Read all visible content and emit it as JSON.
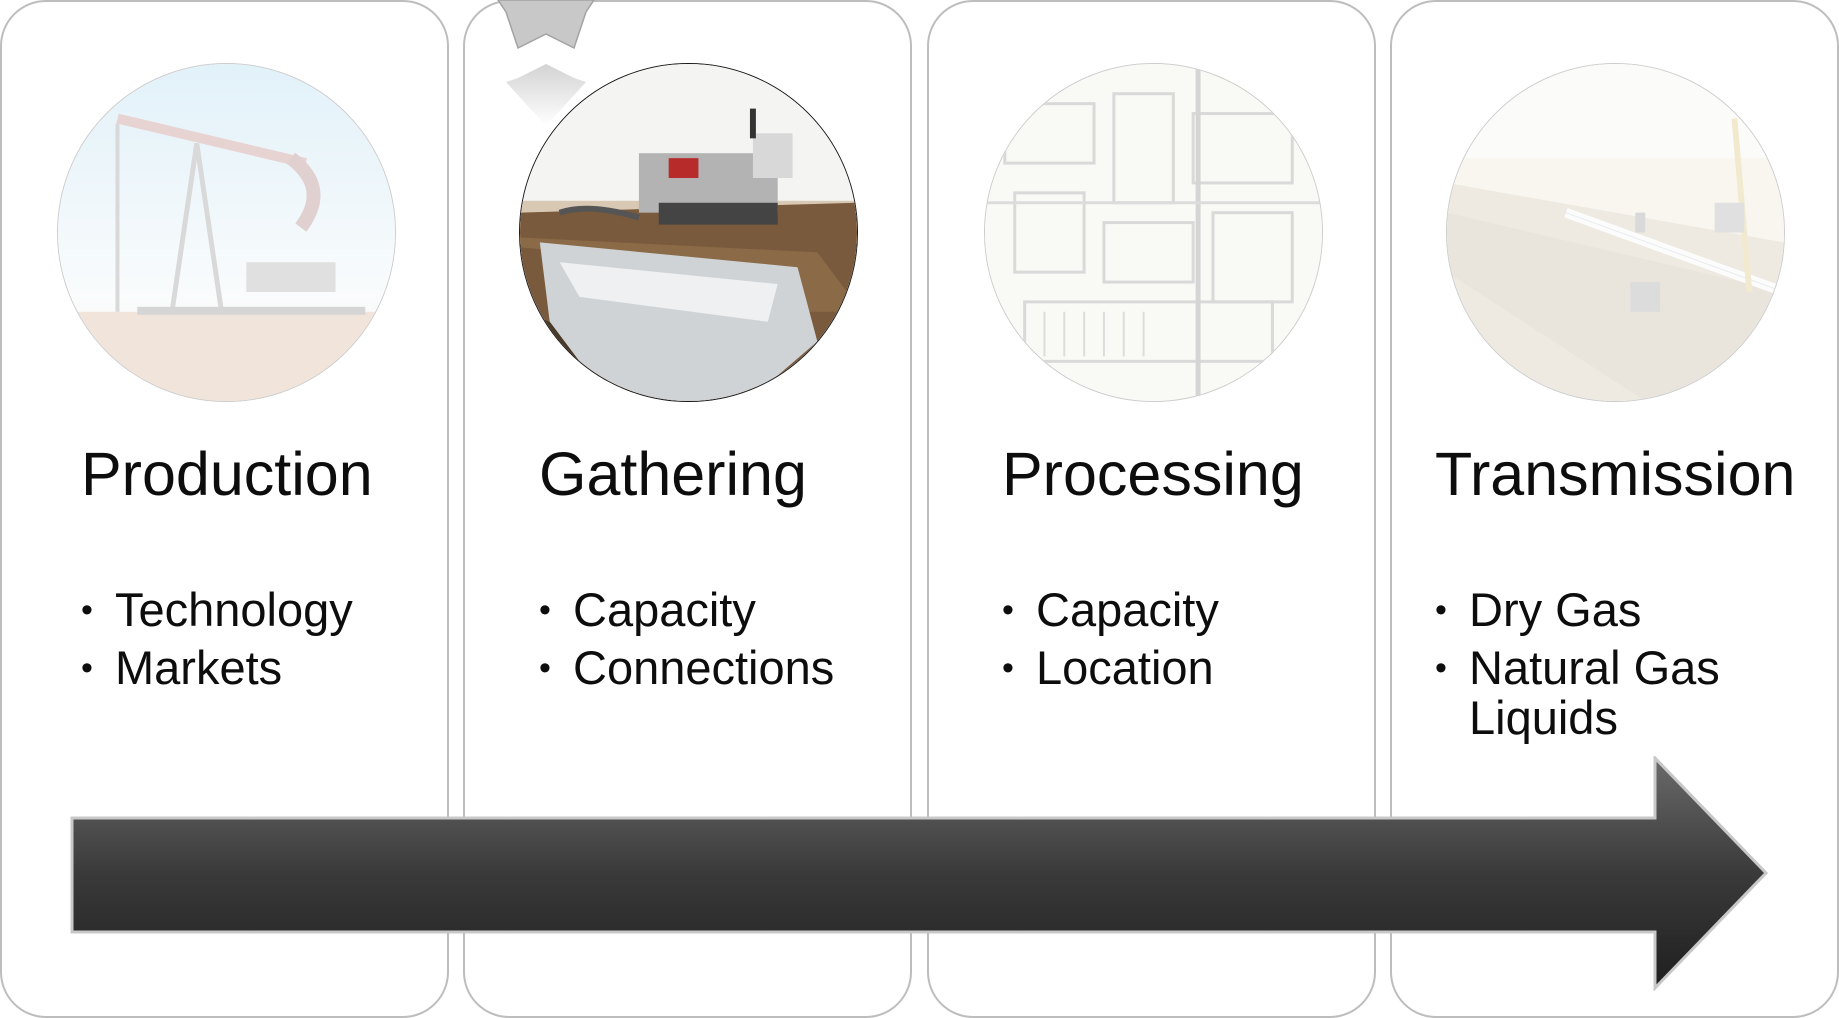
{
  "stages": [
    {
      "title": "Production",
      "bullets": [
        "Technology",
        "Markets"
      ],
      "image": "oil-pumpjack-photo",
      "highlighted": false
    },
    {
      "title": "Gathering",
      "bullets": [
        "Capacity",
        "Connections"
      ],
      "image": "pipeline-trencher-photo",
      "highlighted": true
    },
    {
      "title": "Processing",
      "bullets": [
        "Capacity",
        "Location"
      ],
      "image": "processing-plant-aerial-photo",
      "highlighted": false
    },
    {
      "title": "Transmission",
      "bullets": [
        "Dry Gas",
        "Natural Gas Liquids"
      ],
      "image": "transmission-pipeline-construction-photo",
      "highlighted": false
    }
  ],
  "colors": {
    "panel_border": "#bdbdbd",
    "arrow_dark": "#2b2b2b",
    "arrow_light": "#6a6a6a",
    "star": "#c8c8c8"
  },
  "icons": {
    "active_marker": "star-icon",
    "flow": "right-arrow"
  }
}
